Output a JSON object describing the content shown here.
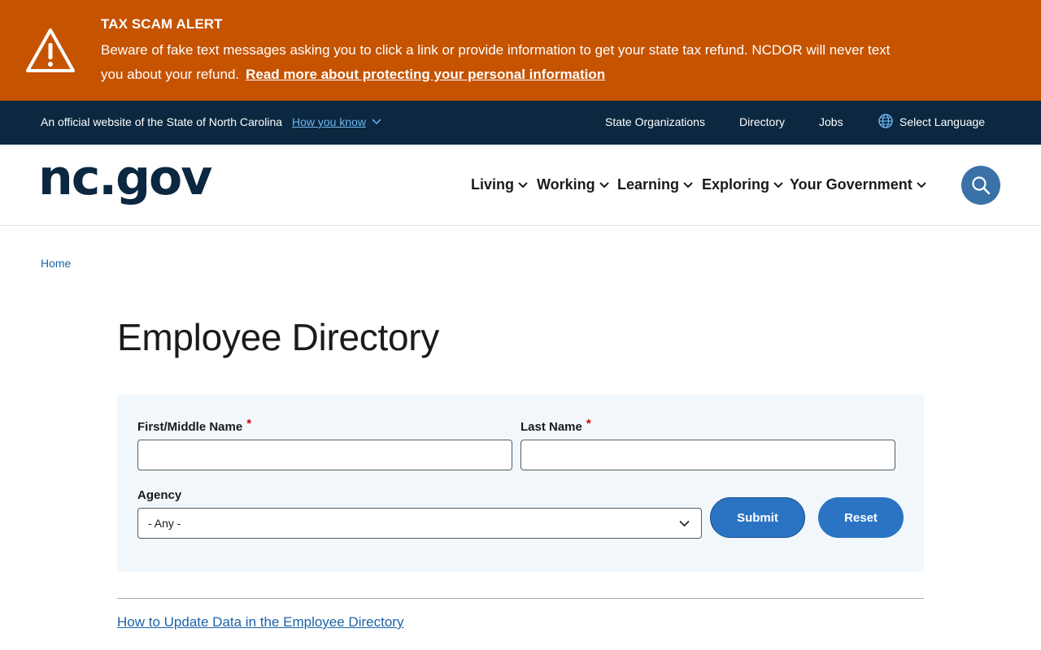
{
  "alert": {
    "title": "TAX SCAM ALERT",
    "message": "Beware of fake text messages asking you to click a link or provide information to get your state tax refund. NCDOR will never text you about your refund.",
    "link_label": "Read more about protecting your personal information",
    "background_color": "#c65300",
    "icon": "warning-icon"
  },
  "official_bar": {
    "text": "An official website of the State of North Carolina",
    "how_you_know": "How you know",
    "links": {
      "state_orgs": "State Organizations",
      "directory": "Directory",
      "jobs": "Jobs",
      "language": "Select Language"
    },
    "background_color": "#0b2840"
  },
  "header": {
    "logo": "nc.gov",
    "nav": {
      "living": "Living",
      "working": "Working",
      "learning": "Learning",
      "exploring": "Exploring",
      "government": "Your Government"
    },
    "search_icon": "search-icon"
  },
  "breadcrumb": {
    "home": "Home"
  },
  "page": {
    "title": "Employee Directory"
  },
  "form": {
    "first_name_label": "First/Middle Name",
    "last_name_label": "Last Name",
    "required_marker": "*",
    "first_name_value": "",
    "last_name_value": "",
    "agency_label": "Agency",
    "agency_selected": "- Any -",
    "submit_label": "Submit",
    "reset_label": "Reset"
  },
  "footer_link": "How to Update Data in the Employee Directory",
  "accent_color": "#2b74c4"
}
